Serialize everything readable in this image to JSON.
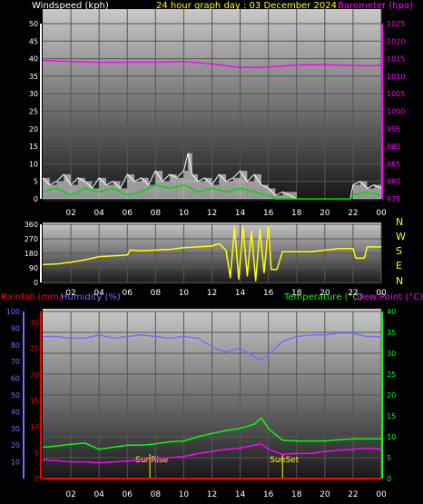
{
  "colors": {
    "wind_label": "#ffffff",
    "title": "#ffff00",
    "barometer": "#ff00ff",
    "direction": "#ffff00",
    "rain": "#ff0000",
    "humidity": "#7070ff",
    "temperature": "#00ff00",
    "dewpoint": "#ff00ff",
    "sun": "#ffff00",
    "tick": "#ffffff"
  },
  "header": {
    "wind_label": "Windspeed (kph)",
    "title": "24 hour graph day : 03 December 2024",
    "baro_label": "Barometer (hpa)"
  },
  "lower_header": {
    "rain_label": "Rainfall (mm)",
    "humidity_label": "Humidity (%)",
    "temp_label": "Temperature (°C)",
    "dew_label": "Dew Point (°C)"
  },
  "compass": [
    "N",
    "W",
    "S",
    "E",
    "N"
  ],
  "time_ticks": [
    "02",
    "04",
    "06",
    "08",
    "10",
    "12",
    "14",
    "16",
    "18",
    "20",
    "22",
    "00"
  ],
  "sun": {
    "rise_label": "SunRise",
    "rise_hour": 7.6,
    "set_label": "SunSet",
    "set_hour": 17.0
  },
  "chart_data": [
    {
      "type": "line",
      "ylabel": "Windspeed (kph)",
      "ylim": [
        0,
        50
      ],
      "y_ticks": [
        "0",
        "5",
        "10",
        "15",
        "20",
        "25",
        "30",
        "35",
        "40",
        "45",
        "50"
      ],
      "y2label": "Barometer (hpa)",
      "y2lim": [
        975,
        1025
      ],
      "y2_ticks": [
        "975",
        "980",
        "985",
        "990",
        "995",
        "1000",
        "1005",
        "1010",
        "1015",
        "1020",
        "1025"
      ],
      "x_ticks": [
        "02",
        "04",
        "06",
        "08",
        "10",
        "12",
        "14",
        "16",
        "18",
        "20",
        "22",
        "00"
      ],
      "series": [
        {
          "name": "Barometer (hpa)",
          "axis": "right",
          "x": [
            0,
            2,
            4,
            6,
            8,
            10,
            12,
            14,
            15,
            16,
            18,
            20,
            22,
            24
          ],
          "values": [
            1014.5,
            1014.2,
            1013.9,
            1014.0,
            1014.0,
            1014.2,
            1013.5,
            1012.5,
            1012.5,
            1012.6,
            1013.2,
            1013.3,
            1013.0,
            1013.0
          ]
        },
        {
          "name": "Windspeed (kph)",
          "axis": "left",
          "style": "gust",
          "x": [
            0,
            0.5,
            1,
            1.5,
            2,
            2.5,
            3,
            3.5,
            4,
            4.5,
            5,
            5.5,
            6,
            6.5,
            7,
            7.5,
            8,
            8.5,
            9,
            9.5,
            10,
            10.3,
            10.6,
            11,
            11.5,
            12,
            12.5,
            13,
            13.5,
            14,
            14.5,
            15,
            15.5,
            16,
            16.5,
            17,
            18,
            20,
            21.8,
            22,
            22.5,
            23,
            23.5,
            24
          ],
          "values": [
            6,
            4,
            5,
            7,
            4,
            6,
            5,
            3,
            6,
            4,
            5,
            3,
            7,
            5,
            6,
            4,
            8,
            5,
            7,
            6,
            8,
            13,
            7,
            5,
            6,
            4,
            7,
            5,
            6,
            8,
            5,
            7,
            4,
            3,
            1,
            2,
            0,
            0,
            0,
            4,
            5,
            3,
            4,
            3
          ]
        },
        {
          "name": "Wind average (kph)",
          "axis": "left",
          "style": "avg",
          "x": [
            0,
            1,
            2,
            3,
            4,
            5,
            6,
            7,
            8,
            9,
            10,
            11,
            12,
            13,
            14,
            15,
            16,
            16.5,
            17,
            18,
            20,
            21.8,
            22,
            23,
            24
          ],
          "values": [
            2,
            3,
            1,
            3,
            2,
            3,
            1,
            2,
            4,
            3,
            4,
            2,
            3,
            2,
            3,
            2,
            1,
            0,
            0,
            0,
            0,
            0,
            1,
            2,
            1
          ]
        }
      ]
    },
    {
      "type": "line",
      "ylabel": "Wind direction",
      "ylim": [
        0,
        360
      ],
      "y_ticks": [
        "0",
        "90",
        "180",
        "270",
        "360"
      ],
      "x_ticks": [
        "02",
        "04",
        "06",
        "08",
        "10",
        "12",
        "14",
        "16",
        "18",
        "20",
        "22",
        "00"
      ],
      "series": [
        {
          "name": "Wind direction",
          "x": [
            0,
            1,
            2,
            3,
            4,
            5,
            6,
            6.2,
            7,
            8,
            9,
            10,
            11,
            12,
            12.5,
            13,
            13.3,
            13.6,
            13.9,
            14.2,
            14.5,
            14.8,
            15.1,
            15.4,
            15.7,
            16.0,
            16.2,
            16.6,
            17,
            18,
            19,
            20,
            21,
            22,
            22.2,
            22.8,
            23,
            24
          ],
          "values": [
            110,
            115,
            125,
            140,
            160,
            165,
            170,
            200,
            195,
            200,
            205,
            215,
            220,
            225,
            240,
            200,
            30,
            340,
            20,
            350,
            40,
            320,
            10,
            330,
            60,
            350,
            80,
            80,
            190,
            190,
            190,
            200,
            210,
            210,
            150,
            150,
            220,
            220
          ]
        }
      ]
    },
    {
      "type": "line",
      "ylabel": "Temperature (°C)",
      "ylim": [
        0,
        40
      ],
      "y_ticks": [
        "0",
        "5",
        "10",
        "15",
        "20",
        "25",
        "30",
        "35",
        "40"
      ],
      "x_ticks": [
        "02",
        "04",
        "06",
        "08",
        "10",
        "12",
        "14",
        "16",
        "18",
        "20",
        "22",
        "00"
      ],
      "left_axis_humidity": [
        "10",
        "20",
        "30",
        "40",
        "50",
        "60",
        "70",
        "80",
        "90",
        "100"
      ],
      "left_axis_rain": [
        "0",
        "5",
        "10",
        "15",
        "20",
        "25",
        "30"
      ],
      "series": [
        {
          "name": "Humidity (%)",
          "axis": "humidity",
          "x": [
            0,
            1,
            2,
            3,
            4,
            5,
            6,
            7,
            8,
            9,
            10,
            11,
            12,
            12.5,
            13,
            14,
            15,
            15.5,
            16,
            17,
            18,
            19,
            20,
            21,
            22,
            23,
            24
          ],
          "values": [
            85,
            85,
            84,
            84,
            86,
            84,
            85,
            86,
            85,
            84,
            85,
            84,
            79,
            77,
            76,
            78,
            73,
            71,
            74,
            82,
            85,
            86,
            86,
            87,
            87,
            85,
            85
          ]
        },
        {
          "name": "Temperature (°C)",
          "axis": "temp",
          "x": [
            0,
            1,
            2,
            3,
            4,
            5,
            6,
            7,
            8,
            9,
            10,
            11,
            12,
            13,
            14,
            15,
            15.5,
            16,
            17,
            18,
            19,
            20,
            21,
            22,
            23,
            24
          ],
          "values": [
            7.5,
            7.8,
            8.2,
            8.5,
            7.0,
            7.5,
            8.0,
            8.0,
            8.3,
            8.8,
            9.0,
            10.0,
            10.8,
            11.5,
            12.0,
            13.0,
            14.5,
            12.0,
            9.2,
            9.0,
            9.0,
            9.0,
            9.3,
            9.5,
            9.5,
            9.5
          ]
        },
        {
          "name": "Dew Point (°C)",
          "axis": "temp",
          "x": [
            0,
            1,
            2,
            3,
            4,
            5,
            6,
            7,
            8,
            9,
            10,
            11,
            12,
            13,
            14,
            15,
            15.5,
            16,
            17,
            18,
            19,
            20,
            21,
            22,
            23,
            24
          ],
          "values": [
            4.5,
            4.3,
            4.0,
            4.0,
            3.8,
            4.0,
            4.2,
            4.5,
            4.8,
            5.0,
            5.3,
            6.0,
            6.5,
            7.0,
            7.3,
            8.0,
            8.3,
            7.0,
            5.8,
            6.0,
            6.0,
            6.5,
            6.8,
            7.0,
            7.3,
            7.0
          ]
        },
        {
          "name": "Rainfall (mm)",
          "axis": "rain",
          "x": [
            0,
            24
          ],
          "values": [
            0,
            0
          ]
        }
      ]
    }
  ]
}
